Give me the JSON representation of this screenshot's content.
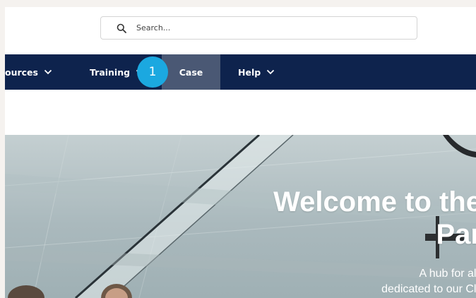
{
  "search": {
    "placeholder": "Search...",
    "icon": "search-icon"
  },
  "nav": {
    "items": [
      {
        "label": "ources",
        "has_dropdown": true
      },
      {
        "label": "Training",
        "has_dropdown": true
      },
      {
        "label": "Case",
        "has_dropdown": false,
        "active": true
      },
      {
        "label": "Help",
        "has_dropdown": true
      }
    ],
    "step_badge": "1"
  },
  "hero": {
    "title_line1": "Welcome to the",
    "title_line2": "Par",
    "subtitle_line1": "A hub for all",
    "subtitle_line2": "dedicated to our Cli"
  },
  "colors": {
    "nav_bg": "#0e234d",
    "nav_active_bg": "#4a5874",
    "badge": "#1ba8e0",
    "page_bg": "#f5f2ef"
  }
}
